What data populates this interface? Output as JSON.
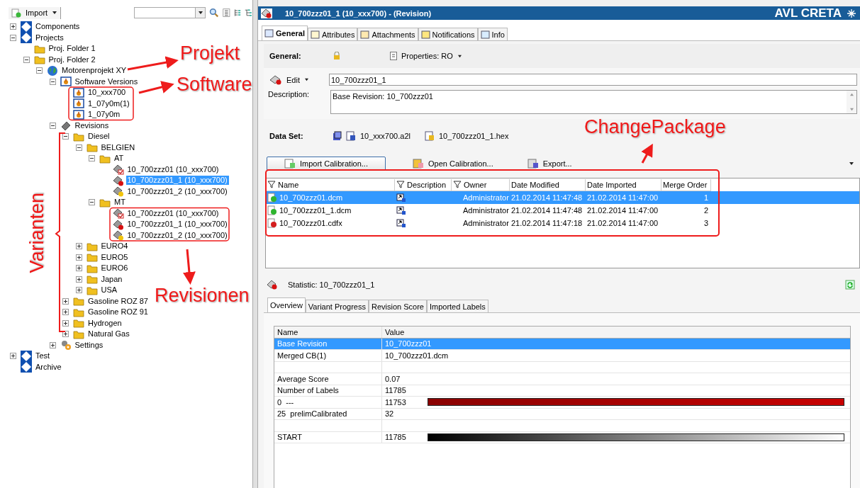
{
  "toolbar": {
    "import_button": "Import"
  },
  "tree": [
    {
      "label": "Components",
      "kind": "root",
      "expanded": false,
      "selected": false
    },
    {
      "label": "Projects",
      "kind": "root",
      "expanded": true,
      "selected": false,
      "children": [
        {
          "label": "Proj. Folder 1",
          "kind": "folder",
          "selected": false
        },
        {
          "label": "Proj. Folder 2",
          "kind": "folder",
          "expanded": true,
          "selected": false,
          "children": [
            {
              "label": "Motorenprojekt XY",
              "kind": "globe",
              "expanded": true,
              "selected": false,
              "children": [
                {
                  "label": "Software Versions",
                  "kind": "software",
                  "expanded": true,
                  "selected": false,
                  "children": [
                    {
                      "label": "10_xxx700",
                      "kind": "software",
                      "selected": false
                    },
                    {
                      "label": "1_07y0m(1)",
                      "kind": "software",
                      "selected": false
                    },
                    {
                      "label": "1_07y0m",
                      "kind": "software",
                      "selected": false
                    }
                  ]
                },
                {
                  "label": "Revisions",
                  "kind": "chip",
                  "expanded": true,
                  "selected": false,
                  "children": [
                    {
                      "label": "Diesel",
                      "kind": "folder",
                      "expanded": true,
                      "selected": false,
                      "children": [
                        {
                          "label": "BELGIEN",
                          "kind": "folder",
                          "expanded": true,
                          "selected": false,
                          "children": [
                            {
                              "label": "AT",
                              "kind": "folder",
                              "expanded": true,
                              "selected": false,
                              "children": [
                                {
                                  "label": "10_700zzz01 (10_xxx700)",
                                  "kind": "revision-checked",
                                  "selected": false
                                },
                                {
                                  "label": "10_700zzz01_1 (10_xxx700)",
                                  "kind": "revision-red",
                                  "selected": true
                                },
                                {
                                  "label": "10_700zzz01_2 (10_xxx700)",
                                  "kind": "revision-yellow",
                                  "selected": false
                                }
                              ]
                            },
                            {
                              "label": "MT",
                              "kind": "folder",
                              "expanded": true,
                              "selected": false,
                              "children": [
                                {
                                  "label": "10_700zzz01 (10_xxx700)",
                                  "kind": "revision-checked",
                                  "selected": false
                                },
                                {
                                  "label": "10_700zzz01_1 (10_xxx700)",
                                  "kind": "revision-red",
                                  "selected": false
                                },
                                {
                                  "label": "10_700zzz01_2 (10_xxx700)",
                                  "kind": "revision-yellow",
                                  "selected": false
                                }
                              ]
                            }
                          ]
                        },
                        {
                          "label": "EURO4",
                          "kind": "folder",
                          "expanded": false,
                          "selected": false
                        },
                        {
                          "label": "EURO5",
                          "kind": "folder",
                          "expanded": false,
                          "selected": false
                        },
                        {
                          "label": "EURO6",
                          "kind": "folder",
                          "expanded": false,
                          "selected": false
                        },
                        {
                          "label": "Japan",
                          "kind": "folder",
                          "expanded": false,
                          "selected": false
                        },
                        {
                          "label": "USA",
                          "kind": "folder",
                          "expanded": false,
                          "selected": false
                        }
                      ]
                    },
                    {
                      "label": "Gasoline ROZ 87",
                      "kind": "folder",
                      "expanded": false,
                      "selected": false
                    },
                    {
                      "label": "Gasoline ROZ 91",
                      "kind": "folder",
                      "expanded": false,
                      "selected": false
                    },
                    {
                      "label": "Hydrogen",
                      "kind": "folder",
                      "expanded": false,
                      "selected": false
                    },
                    {
                      "label": "Natural Gas",
                      "kind": "folder",
                      "expanded": false,
                      "selected": false
                    }
                  ]
                },
                {
                  "label": "Settings",
                  "kind": "settings",
                  "expanded": false,
                  "selected": false
                }
              ]
            }
          ]
        }
      ]
    },
    {
      "label": "Test",
      "kind": "root",
      "expanded": false,
      "selected": false
    },
    {
      "label": "Archive",
      "kind": "root",
      "selected": false
    }
  ],
  "header": {
    "title": "10_700zzz01_1 (10_xxx700) - (Revision)",
    "brand": "AVL CRETA"
  },
  "tabs": [
    {
      "label": "General",
      "selected": true
    },
    {
      "label": "Attributes",
      "selected": false
    },
    {
      "label": "Attachments",
      "selected": false
    },
    {
      "label": "Notifications",
      "selected": false
    },
    {
      "label": "Info",
      "selected": false
    }
  ],
  "general": {
    "label": "General:",
    "properties": "Properties: RO",
    "edit": "Edit",
    "name_value": "10_700zzz01_1",
    "description_label": "Description:",
    "description_value": "Base Revision: 10_700zzz01"
  },
  "data_set": {
    "label": "Data Set:",
    "files": [
      "10_xxx700.a2l",
      "10_700zzz01_1.hex"
    ]
  },
  "actions": [
    "Import Calibration...",
    "Open Calibration...",
    "Export..."
  ],
  "calibrations": {
    "columns": [
      "Name",
      "Description",
      "Owner",
      "Date Modified",
      "Date Imported",
      "Merge Order"
    ],
    "rows": [
      {
        "name": "10_700zzz01.dcm",
        "color": "#2fb52f",
        "owner": "Administrator",
        "modified": "21.02.2014 11:47:48",
        "imported": "21.02.2014 11:47:00",
        "order": "1",
        "selected": true
      },
      {
        "name": "10_700zzz01_1.dcm",
        "color": "#2fb52f",
        "owner": "Administrator",
        "modified": "21.02.2014 11:47:48",
        "imported": "21.02.2014 11:47:00",
        "order": "2",
        "selected": false
      },
      {
        "name": "10_700zzz01.cdfx",
        "color": "#d41e1e",
        "owner": "Administrator",
        "modified": "21.02.2014 11:47:18",
        "imported": "21.02.2014 11:47:00",
        "order": "3",
        "selected": false
      }
    ]
  },
  "statistic": {
    "title": "Statistic: 10_700zzz01_1",
    "tabs": [
      {
        "label": "Overview",
        "selected": true
      },
      {
        "label": "Variant Progress",
        "selected": false
      },
      {
        "label": "Revision Score",
        "selected": false
      },
      {
        "label": "Imported Labels",
        "selected": false
      }
    ],
    "columns": [
      "Name",
      "Value"
    ],
    "rows": [
      {
        "kind": "text",
        "name": "Base Revision",
        "value": "10_700zzz01",
        "selected": true
      },
      {
        "kind": "text",
        "name": "Merged CB(1)",
        "value": "10_700zzz01.dcm",
        "selected": false
      },
      {
        "kind": "spacer",
        "selected": false
      },
      {
        "kind": "text",
        "name": "Average Score",
        "value": "0.07",
        "selected": false
      },
      {
        "kind": "text",
        "name": "Number of Labels",
        "value": "11785",
        "selected": false
      },
      {
        "kind": "red-bar",
        "name": "0  ---",
        "value": "11753",
        "selected": false
      },
      {
        "kind": "text",
        "name": "25  prelimCalibrated",
        "value": "32",
        "selected": false
      },
      {
        "kind": "spacer",
        "selected": false
      },
      {
        "kind": "gradient-bar",
        "name": "START",
        "value": "11785",
        "selected": false
      }
    ]
  },
  "annotations": {
    "project": "Projekt",
    "software": "Software",
    "change_package": "ChangePackage",
    "variants": "Varianten",
    "revisions": "Revisionen"
  }
}
